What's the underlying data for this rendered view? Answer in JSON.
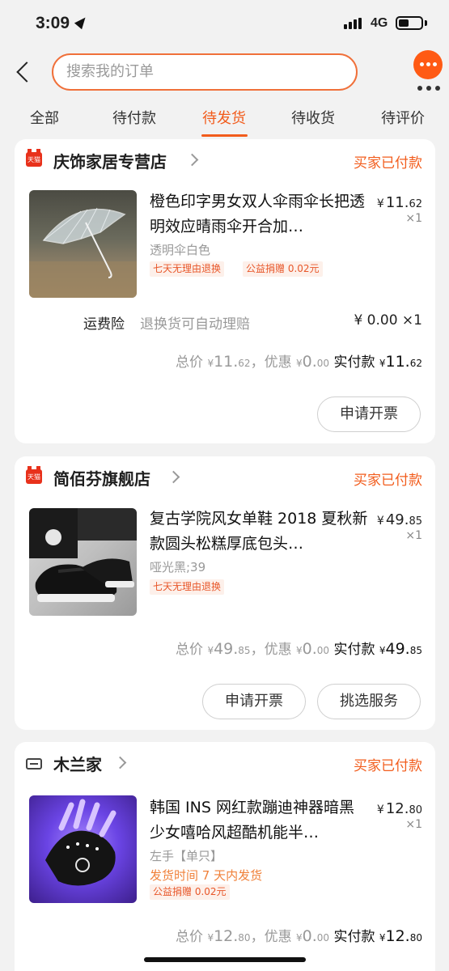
{
  "status_bar": {
    "time": "3:09",
    "network": "4G",
    "battery_level": 0.45
  },
  "header": {
    "search_placeholder": "搜索我的订单"
  },
  "tabs": [
    {
      "label": "全部"
    },
    {
      "label": "待付款"
    },
    {
      "label": "待发货",
      "active": true
    },
    {
      "label": "待收货"
    },
    {
      "label": "待评价"
    }
  ],
  "orders": [
    {
      "shop": "庆饰家居专营店",
      "shop_logo_text": "天猫",
      "status": "买家已付款",
      "item": {
        "title": "橙色印字男女双人伞雨伞长把透明效应晴雨伞开合加…",
        "price_main": "11.",
        "price_cents": "62",
        "qty": "×1",
        "sku": "透明伞白色",
        "tags": [
          "七天无理由退换",
          "公益捐赠 0.02元"
        ]
      },
      "insurance": {
        "label": "运费险",
        "desc": "退换货可自动理赔",
        "price": "¥ 0.00 ×1"
      },
      "totals": {
        "total_label": "总价",
        "total_main": "11.",
        "total_cents": "62",
        "discount_label": "，优惠",
        "discount_main": "0.",
        "discount_cents": "00",
        "paid_label": "实付款",
        "paid_main": "11.",
        "paid_cents": "62"
      },
      "buttons": [
        "申请开票"
      ]
    },
    {
      "shop": "简佰芬旗舰店",
      "shop_logo_text": "天猫",
      "status": "买家已付款",
      "item": {
        "title": "复古学院风女单鞋 2018 夏秋新款圆头松糕厚底包头…",
        "price_main": "49.",
        "price_cents": "85",
        "qty": "×1",
        "sku": "哑光黑;39",
        "tags": [
          "七天无理由退换"
        ]
      },
      "totals": {
        "total_label": "总价",
        "total_main": "49.",
        "total_cents": "85",
        "discount_label": "，优惠",
        "discount_main": "0.",
        "discount_cents": "00",
        "paid_label": "实付款",
        "paid_main": "49.",
        "paid_cents": "85"
      },
      "buttons": [
        "申请开票",
        "挑选服务"
      ]
    },
    {
      "shop": "木兰家",
      "status": "买家已付款",
      "item": {
        "title": "韩国 INS 网红款蹦迪神器暗黑少女嘻哈风超酷机能半…",
        "price_main": "12.",
        "price_cents": "80",
        "qty": "×1",
        "sku": "左手【单只】",
        "ship_time": "发货时间  7 天内发货",
        "tags": [
          "公益捐赠 0.02元"
        ]
      },
      "totals": {
        "total_label": "总价",
        "total_main": "12.",
        "total_cents": "80",
        "discount_label": "，优惠",
        "discount_main": "0.",
        "discount_cents": "00",
        "paid_label": "实付款",
        "paid_main": "12.",
        "paid_cents": "80"
      }
    }
  ],
  "currency_symbol": "¥",
  "colors": {
    "accent": "#f25c1c",
    "tmall_red": "#e8311b",
    "background": "#f2f2f2"
  }
}
